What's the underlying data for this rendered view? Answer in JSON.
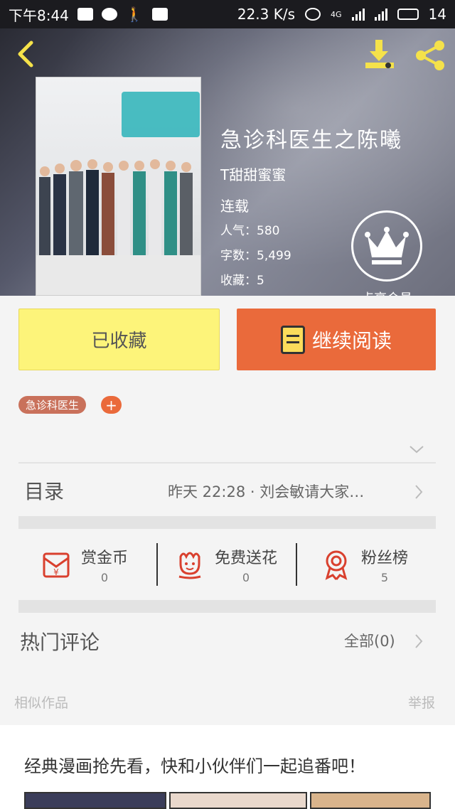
{
  "statusbar": {
    "time": "下午8:44",
    "speed": "22.3 K/s",
    "network": "4G",
    "battery": "14"
  },
  "book": {
    "title": "急诊科医生之陈曦",
    "author": "T甜甜蜜蜜",
    "status": "连载",
    "stats": [
      {
        "label": "人气：",
        "value": "580"
      },
      {
        "label": "字数：",
        "value": "5,499"
      },
      {
        "label": "收藏：",
        "value": "5"
      }
    ]
  },
  "vip": {
    "label": "点亮会员"
  },
  "actions": {
    "collected": "已收藏",
    "read": "继续阅读"
  },
  "tags": [
    "急诊科医生"
  ],
  "tag_add": "+",
  "toc": {
    "label": "目录",
    "latest": "昨天 22:28 · 刘会敏请大家…"
  },
  "engagement": [
    {
      "label": "赏金币",
      "value": "0",
      "icon": "coin-envelope-icon"
    },
    {
      "label": "免费送花",
      "value": "0",
      "icon": "flower-icon"
    },
    {
      "label": "粉丝榜",
      "value": "5",
      "icon": "award-ribbon-icon"
    }
  ],
  "comments": {
    "label": "热门评论",
    "all": "全部(0)"
  },
  "footer": {
    "similar": "相似作品",
    "report": "举报"
  },
  "promo": {
    "text": "经典漫画抢先看，快和小伙伴们一起追番吧！"
  },
  "colors": {
    "accent": "#ea6a3b",
    "collected_bg": "#fdf47a",
    "tag_bg": "#c9715b",
    "icon_red": "#d9402e",
    "icon_yellow": "#f5e24a"
  }
}
